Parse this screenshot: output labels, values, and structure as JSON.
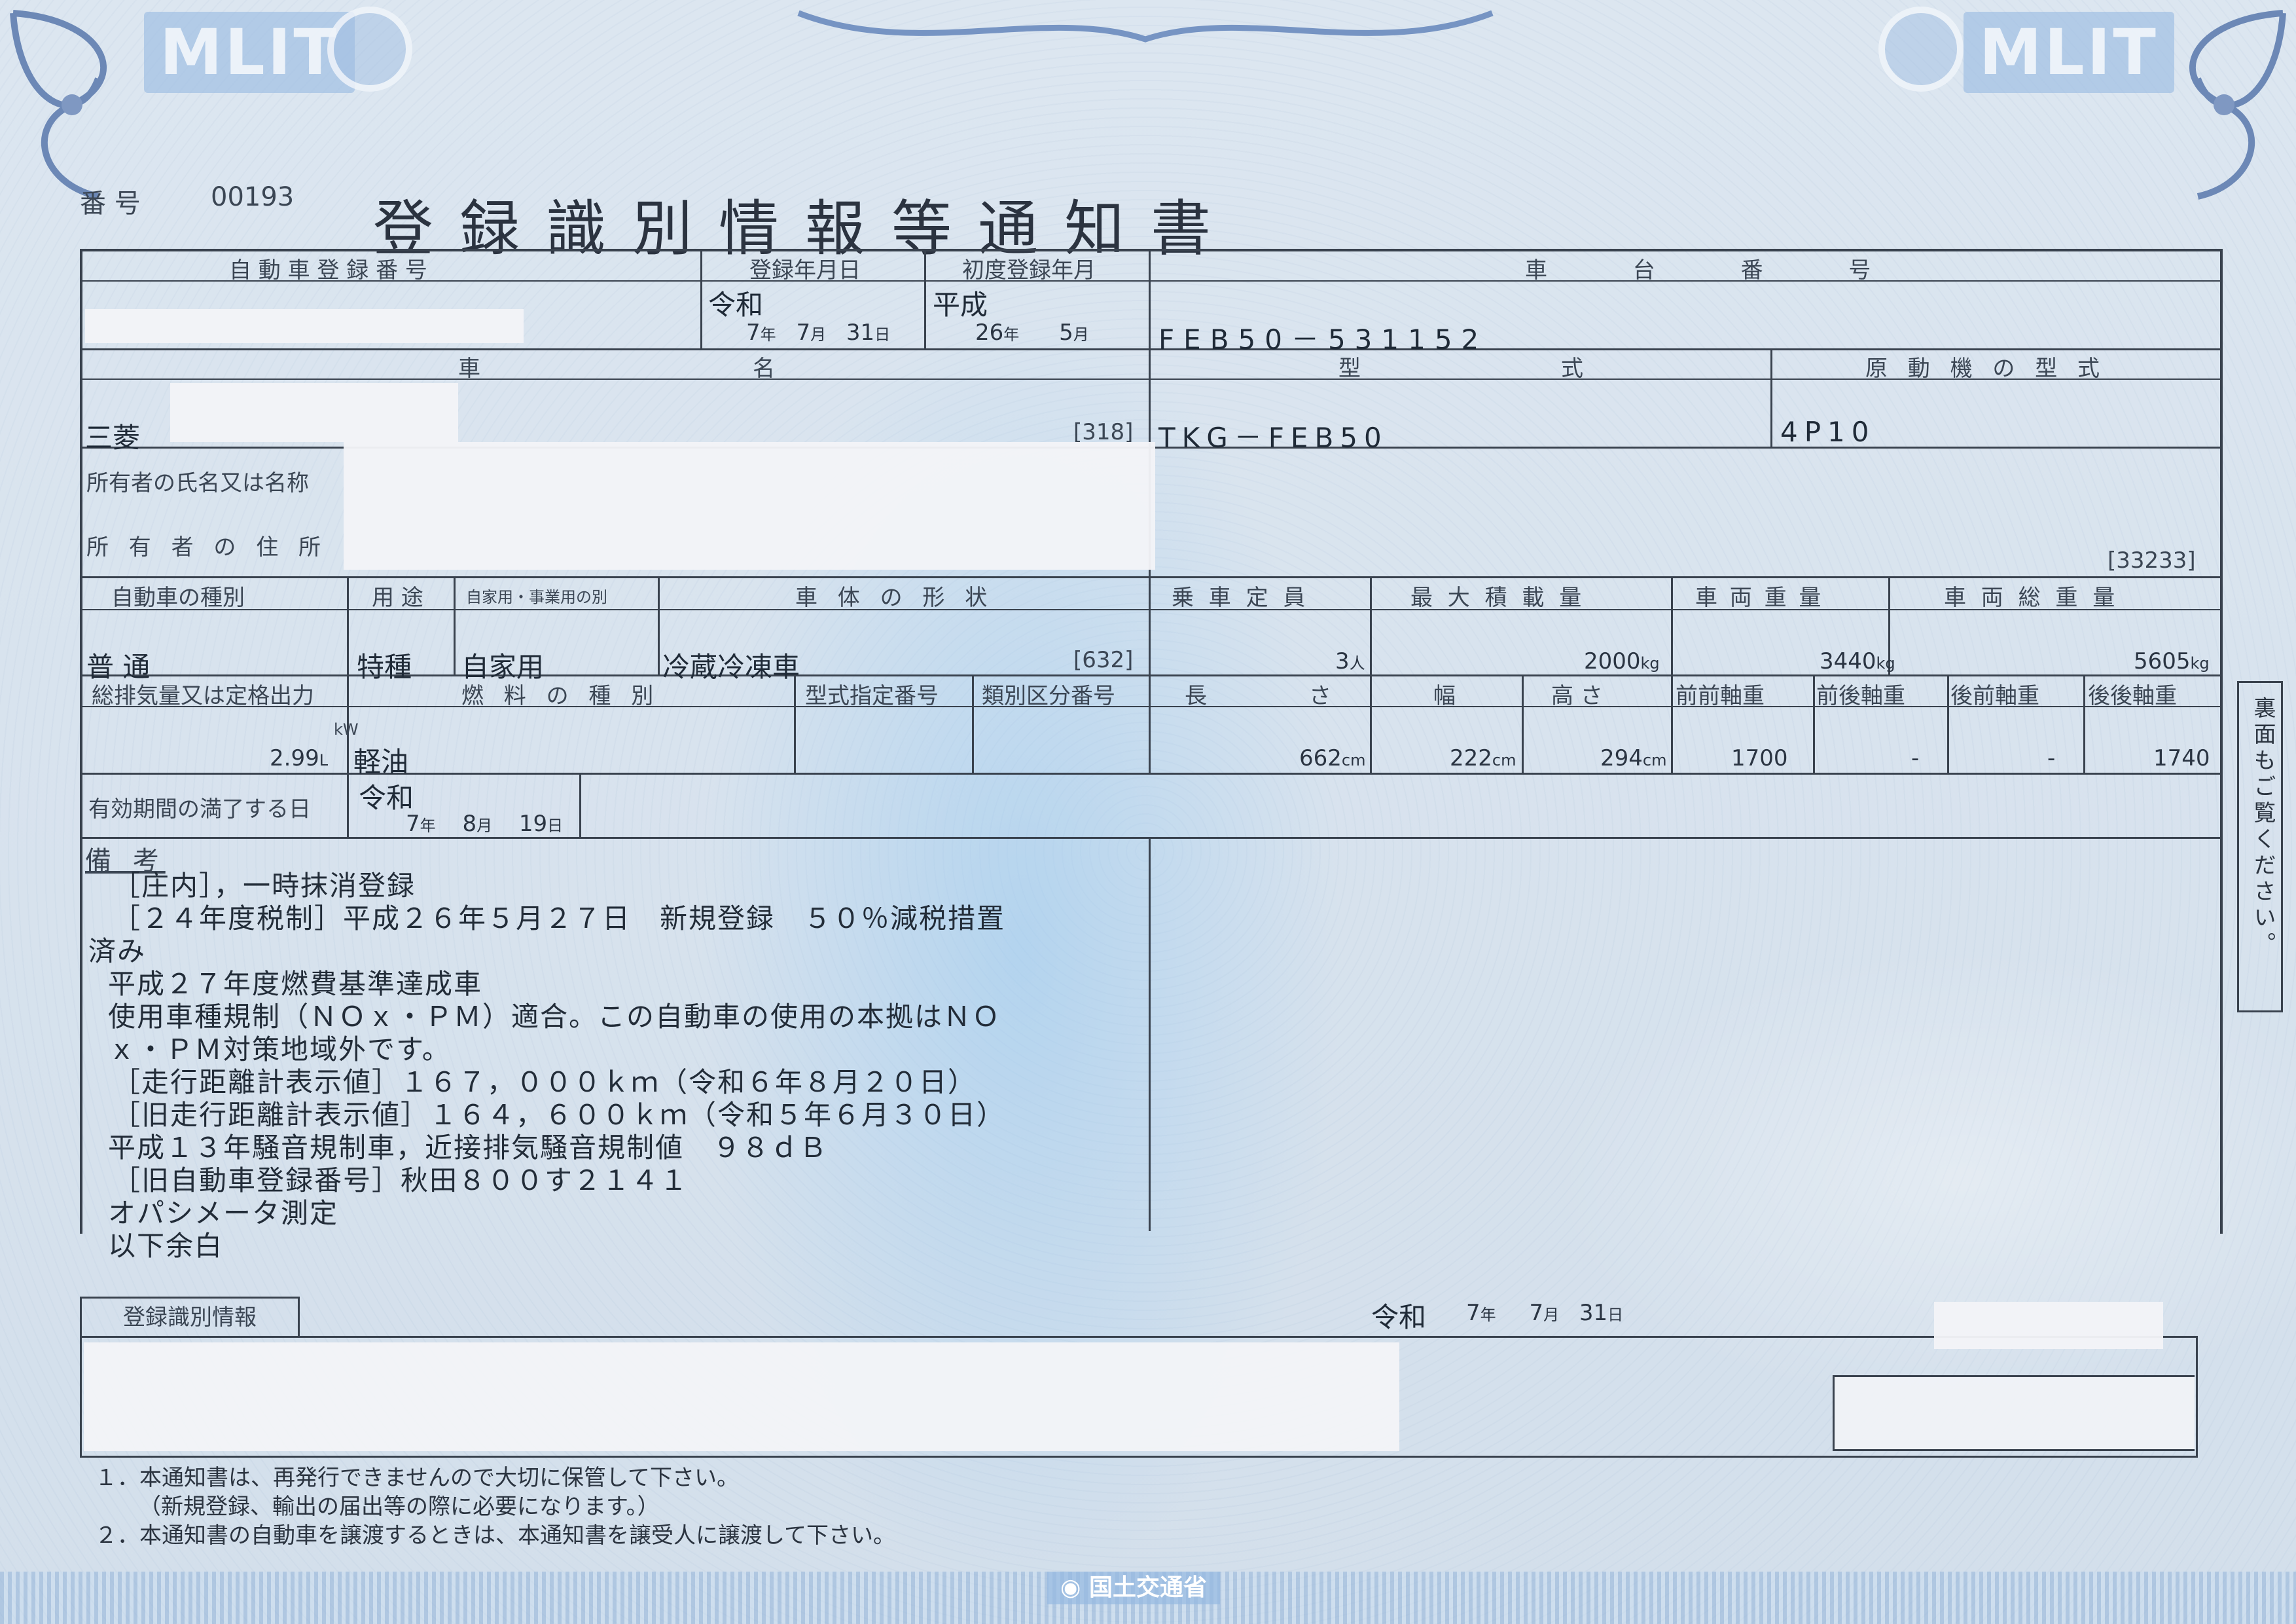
{
  "header": {
    "logo_text": "MLIT",
    "number_label": "番 号",
    "number_value": "00193",
    "title": "登録識別情報等通知書"
  },
  "row1": {
    "reg_number_label": "自 動 車 登 録 番 号",
    "reg_date_label": "登録年月日",
    "first_reg_label": "初度登録年月",
    "chassis_label": "車 台 番 号",
    "reg_date": {
      "era": "令和",
      "year": "7",
      "year_unit": "年",
      "month": "7",
      "month_unit": "月",
      "day": "31",
      "day_unit": "日"
    },
    "first_reg": {
      "era": "平成",
      "year": "26",
      "year_unit": "年",
      "month": "5",
      "month_unit": "月"
    },
    "chassis_value": "FEB50－531152"
  },
  "row2": {
    "name_label_1": "車",
    "name_label_2": "名",
    "model_label_1": "型",
    "model_label_2": "式",
    "engine_label": "原 動 機 の 型 式",
    "name_value": "三菱",
    "name_code": "[318]",
    "model_value": "TKG－FEB50",
    "engine_value": "4P10"
  },
  "owner": {
    "name_label": "所有者の氏名又は名称",
    "address_label": "所 有 者 の 住 所",
    "address_code": "[33233]"
  },
  "row4": {
    "type_label": "自動車の種別",
    "use_label": "用 途",
    "private_label": "自家用・事業用の別",
    "body_label": "車 体 の 形 状",
    "capacity_label": "乗 車 定 員",
    "max_load_label": "最 大 積 載 量",
    "weight_label": "車 両 重 量",
    "gross_label": "車 両 総 重 量",
    "type_value": "普 通",
    "use_value": "特種",
    "private_value": "自家用",
    "body_value": "冷蔵冷凍車",
    "body_code": "[632]",
    "capacity_value": "3",
    "capacity_unit": "人",
    "max_load_value": "2000",
    "weight_value": "3440",
    "gross_value": "5605",
    "kg": "kg"
  },
  "row5": {
    "displacement_label": "総排気量又は定格出力",
    "fuel_label": "燃 料 の 種 別",
    "model_spec_label": "型式指定番号",
    "class_label": "類別区分番号",
    "length_label_1": "長",
    "length_label_2": "さ",
    "width_label": "幅",
    "height_label": "高 さ",
    "ff_axle_label": "前前軸重",
    "fr_axle_label": "前後軸重",
    "rf_axle_label": "後前軸重",
    "rr_axle_label": "後後軸重",
    "kw_unit": "kW",
    "l_unit": "L",
    "displacement_value": "2.99",
    "fuel_value": "軽油",
    "length_value": "662",
    "width_value": "222",
    "height_value": "294",
    "cm": "cm",
    "ff_axle_value": "1700",
    "fr_axle_value": "-",
    "rf_axle_value": "-",
    "rr_axle_value": "1740"
  },
  "expiry": {
    "label": "有効期間の満了する日",
    "era": "令和",
    "year": "7",
    "month": "8",
    "day": "19"
  },
  "remarks": {
    "label": "備 考",
    "lines": [
      "［庄内］，一時抹消登録",
      "［２４年度税制］平成２６年５月２７日　新規登録　５０％減税措置",
      "済み",
      "平成２７年度燃費基準達成車",
      "使用車種規制（ＮＯｘ・ＰＭ）適合。この自動車の使用の本拠はＮＯ",
      "ｘ・ＰＭ対策地域外です。",
      "［走行距離計表示値］１６７，０００ｋｍ（令和６年８月２０日）",
      "［旧走行距離計表示値］１６４，６００ｋｍ（令和５年６月３０日）",
      "平成１３年騒音規制車，近接排気騒音規制値　９８ｄＢ",
      "［旧自動車登録番号］秋田８００す２１４１",
      "オパシメータ測定",
      "以下余白"
    ]
  },
  "reg_info": {
    "label": "登録識別情報",
    "issue_era": "令和",
    "issue_year": "7",
    "issue_month": "7",
    "issue_day": "31"
  },
  "side_note": "裏面もご覧ください。",
  "notes": [
    "１．本通知書は、再発行できませんので大切に保管して下さい。",
    "　（新規登録、輸出の届出等の際に必要になります。）",
    "２．本通知書の自動車を譲渡するときは、本通知書を譲受人に譲渡して下さい。"
  ],
  "footer_logo": "国土交通省",
  "units": {
    "year": "年",
    "month": "月",
    "day": "日"
  }
}
